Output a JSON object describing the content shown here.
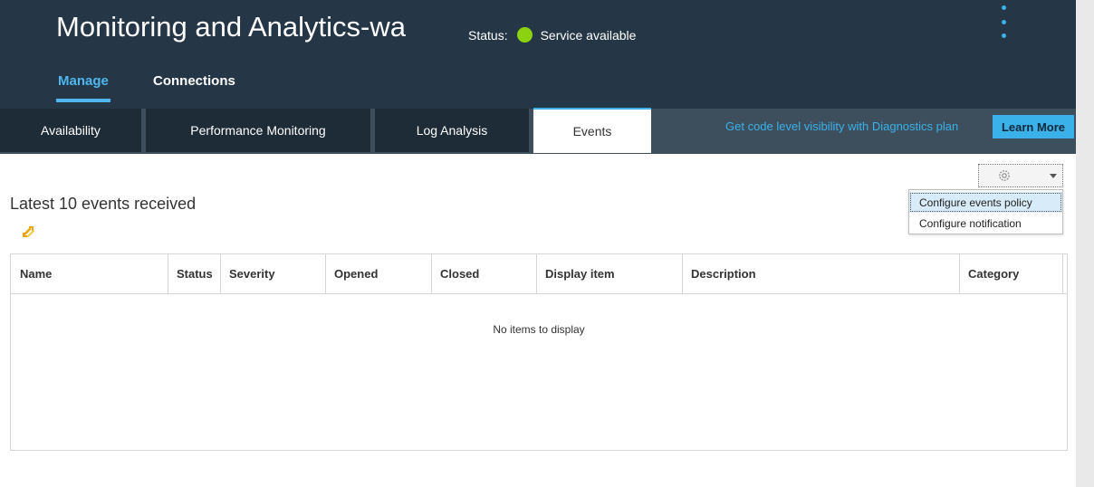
{
  "header": {
    "title": "Monitoring and Analytics-wa",
    "status_label": "Status:",
    "status_text": "Service available",
    "status_color": "#8cd211",
    "menu_icon": "kebab-menu-icon"
  },
  "nav": {
    "tabs": [
      {
        "label": "Manage",
        "active": true
      },
      {
        "label": "Connections",
        "active": false
      }
    ]
  },
  "subnav": {
    "tabs": [
      {
        "label": "Availability"
      },
      {
        "label": "Performance Monitoring"
      },
      {
        "label": "Log Analysis"
      },
      {
        "label": "Events",
        "active": true
      }
    ],
    "promo_text": "Get code level visibility with Diagnostics plan",
    "learn_more": "Learn More"
  },
  "content": {
    "section_title": "Latest 10 events received",
    "refresh_icon": "refresh-icon",
    "settings_dropdown": {
      "icon": "gear-icon",
      "menu_items": [
        "Configure events policy",
        "Configure notification"
      ],
      "highlighted_index": 0
    },
    "table": {
      "columns": [
        "Name",
        "Status",
        "Severity",
        "Opened",
        "Closed",
        "Display item",
        "Description",
        "Category"
      ],
      "empty_text": "No items to display"
    }
  },
  "colors": {
    "header_bg": "#253746",
    "accent": "#3ab1e9",
    "status_ok": "#8cd211"
  }
}
